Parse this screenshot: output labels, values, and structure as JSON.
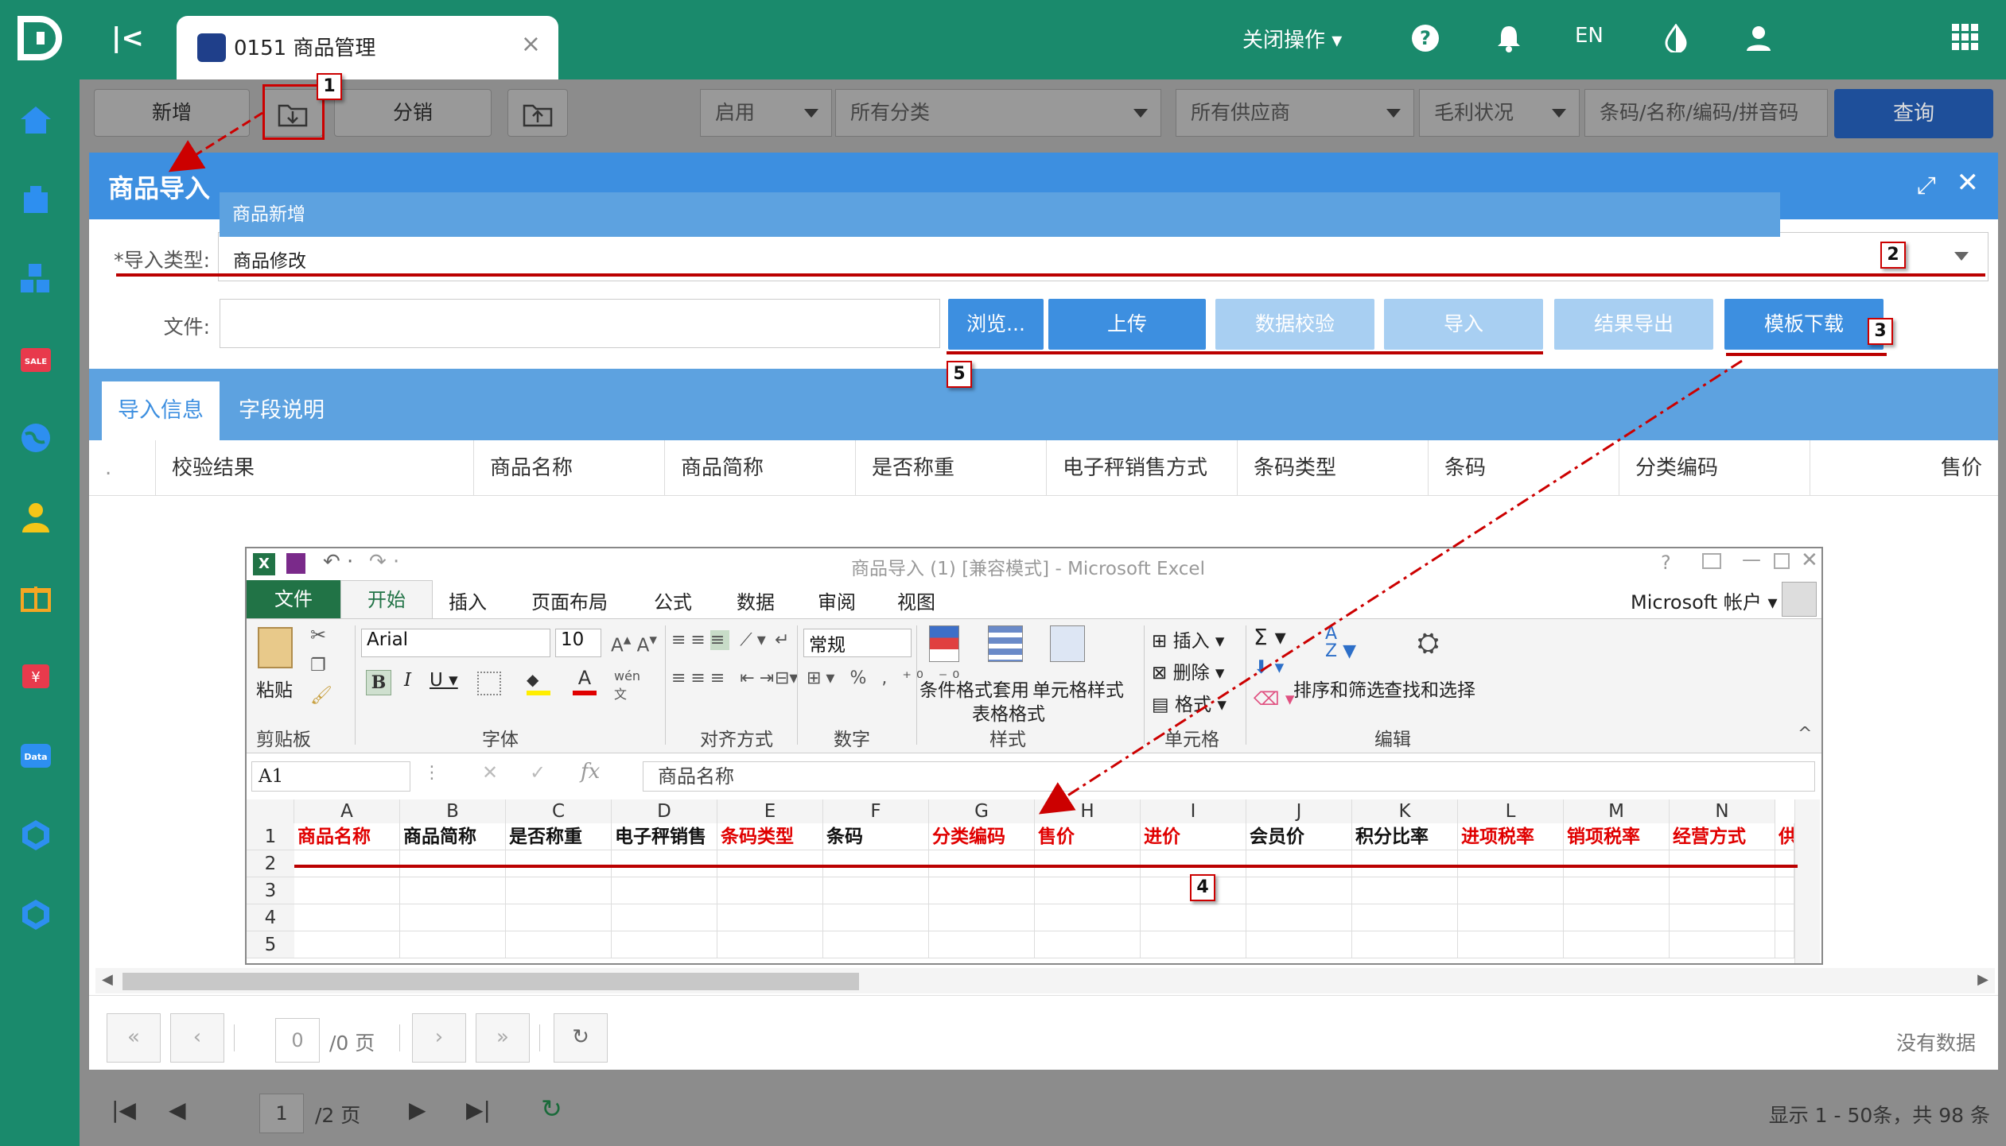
{
  "topbar": {
    "tab_label": "0151 商品管理",
    "close_ops": "关闭操作",
    "lang": "EN"
  },
  "toolbar": {
    "add": "新增",
    "distribute": "分销",
    "status_select": "启用",
    "category_select": "所有分类",
    "supplier_select": "所有供应商",
    "margin_select": "毛利状况",
    "search_placeholder": "条码/名称/编码/拼音码",
    "query": "查询"
  },
  "modal": {
    "title": "商品导入",
    "dropdown_option_new": "商品新增",
    "type_label": "*导入类型:",
    "type_value": "商品修改",
    "file_label": "文件:",
    "browse": "浏览...",
    "upload": "上传",
    "validate": "数据校验",
    "import": "导入",
    "export_result": "结果导出",
    "template_download": "模板下载",
    "tabs": [
      "导入信息",
      "字段说明"
    ],
    "columns": [
      ".",
      "校验结果",
      "商品名称",
      "商品简称",
      "是否称重",
      "电子秤销售方式",
      "条码类型",
      "条码",
      "分类编码",
      "售价"
    ]
  },
  "excel": {
    "title": "商品导入 (1)  [兼容模式] - Microsoft Excel",
    "file_tab": "文件",
    "tabs": [
      "开始",
      "插入",
      "页面布局",
      "公式",
      "数据",
      "审阅",
      "视图"
    ],
    "account": "Microsoft 帐户",
    "font_name": "Arial",
    "font_size": "10",
    "number_format": "常规",
    "groups": [
      "剪贴板",
      "字体",
      "对齐方式",
      "数字",
      "样式",
      "单元格",
      "编辑"
    ],
    "paste": "粘贴",
    "cond_format": "条件格式",
    "table_format_1": "套用",
    "table_format_2": "表格格式",
    "cell_style": "单元格样式",
    "insert": "插入",
    "delete": "删除",
    "format": "格式",
    "sort_filter": "排序和筛选",
    "find_select": "查找和选择",
    "name_box": "A1",
    "formula_value": "商品名称",
    "col_letters": [
      "A",
      "B",
      "C",
      "D",
      "E",
      "F",
      "G",
      "H",
      "I",
      "J",
      "K",
      "L",
      "M",
      "N"
    ],
    "row_numbers": [
      "1",
      "2",
      "3",
      "4",
      "5"
    ],
    "header_cells": [
      {
        "text": "商品名称",
        "required": true
      },
      {
        "text": "商品简称",
        "required": false
      },
      {
        "text": "是否称重",
        "required": false
      },
      {
        "text": "电子秤销售",
        "required": false
      },
      {
        "text": "条码类型",
        "required": true
      },
      {
        "text": "条码",
        "required": false
      },
      {
        "text": "分类编码",
        "required": true
      },
      {
        "text": "售价",
        "required": true
      },
      {
        "text": "进价",
        "required": true
      },
      {
        "text": "会员价",
        "required": false
      },
      {
        "text": "积分比率",
        "required": false
      },
      {
        "text": "进项税率",
        "required": true
      },
      {
        "text": "销项税率",
        "required": true
      },
      {
        "text": "经营方式",
        "required": true
      },
      {
        "text": "供",
        "required": true
      }
    ]
  },
  "pager": {
    "page": "0",
    "total": "/0 页",
    "no_data": "没有数据"
  },
  "bg_pager": {
    "page": "1",
    "total": "/2 页",
    "summary": "显示 1 - 50条，共 98 条"
  },
  "callouts": [
    "1",
    "2",
    "3",
    "4",
    "5"
  ],
  "colors": {
    "brand_green": "#1a8a6c",
    "modal_blue": "#3d8fe0",
    "excel_green": "#217346",
    "required_red": "#e00000"
  }
}
